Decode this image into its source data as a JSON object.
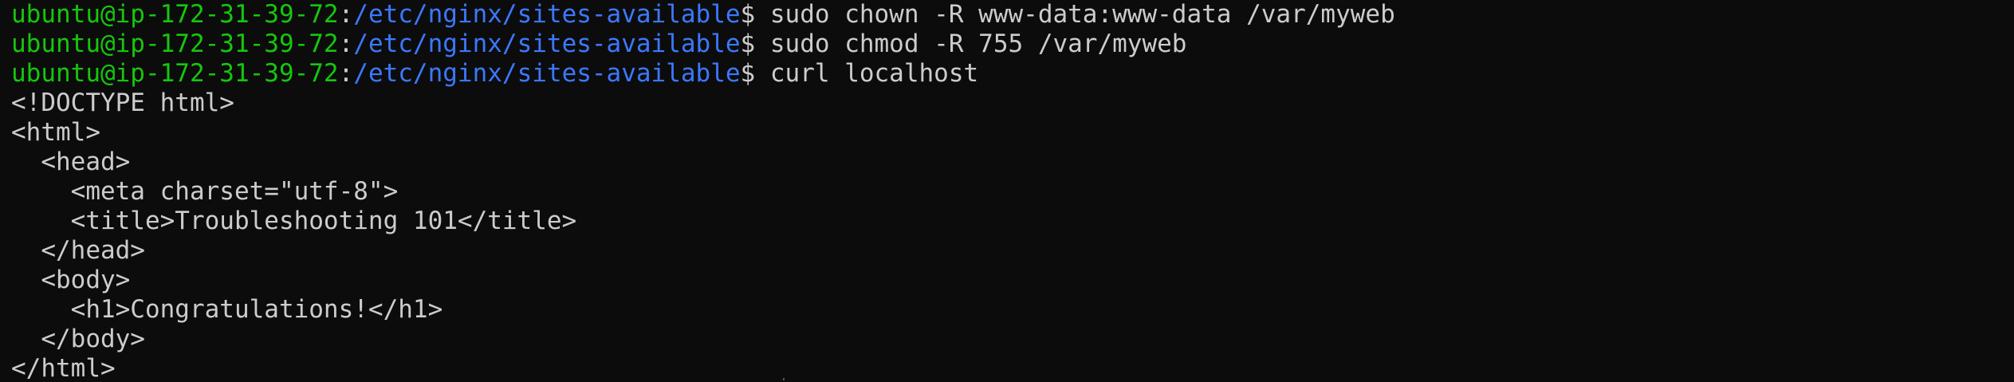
{
  "prompt": {
    "user_host": "ubuntu@ip-172-31-39-72",
    "separator": ":",
    "cwd": "/etc/nginx/sites-available",
    "symbol": "$ "
  },
  "commands": [
    "sudo chown -R www-data:www-data /var/myweb",
    "sudo chmod -R 755 /var/myweb",
    "curl localhost"
  ],
  "output": [
    "<!DOCTYPE html>",
    "<html>",
    "  <head>",
    "    <meta charset=\"utf-8\">",
    "    <title>Troubleshooting 101</title>",
    "  </head>",
    "  <body>",
    "    <h1>Congratulations!</h1>",
    "  </body>",
    "</html>"
  ],
  "colors": {
    "background": "#0c0c0c",
    "foreground": "#cccccc",
    "user_host": "#16c60c",
    "path": "#3b78ff"
  }
}
